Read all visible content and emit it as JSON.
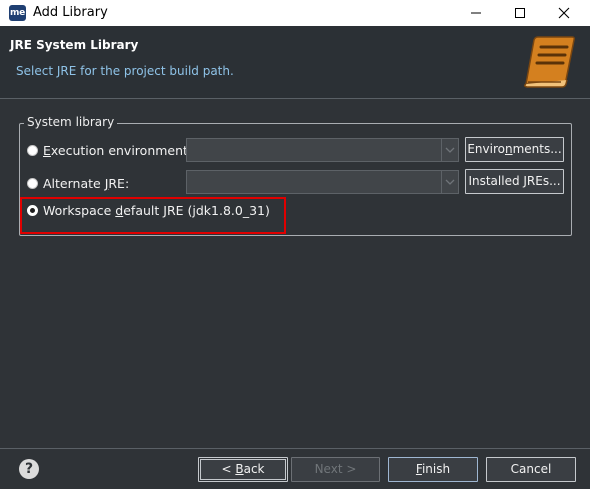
{
  "window": {
    "title": "Add Library",
    "app_icon_text": "me",
    "minimize_icon": "minimize-icon",
    "maximize_icon": "maximize-icon",
    "close_icon": "close-icon"
  },
  "header": {
    "title": "JRE System Library",
    "message": "Select JRE for the project build path.",
    "icon": "library-book-icon",
    "icon_color": "#d4801f"
  },
  "group": {
    "label": "System library",
    "options": [
      {
        "label_pre": "",
        "label_mnemonic": "E",
        "label_post": "xecution environment:",
        "selected": false
      },
      {
        "label_pre": "Alternate ",
        "label_mnemonic": "J",
        "label_post": "RE:",
        "selected": false
      },
      {
        "label_pre": "Workspace ",
        "label_mnemonic": "d",
        "label_post": "efault JRE (jdk1.8.0_31)",
        "selected": true
      }
    ],
    "execution_env_value": "",
    "alternate_jre_value": "",
    "environments_button": {
      "pre": "Enviro",
      "mnemonic": "n",
      "post": "ments..."
    },
    "installed_jres_button": {
      "pre": "Installed JREs...",
      "mnemonic": "",
      "post": ""
    }
  },
  "footer": {
    "help_icon": "help-icon",
    "back_button": {
      "pre": "< ",
      "mnemonic": "B",
      "post": "ack"
    },
    "next_button": "Next >",
    "finish_button": {
      "pre": "",
      "mnemonic": "F",
      "post": "inish"
    },
    "cancel_button": "Cancel"
  },
  "colors": {
    "accent_highlight": "#e00000",
    "background": "#2f3337",
    "header_message": "#8fc3e8"
  }
}
